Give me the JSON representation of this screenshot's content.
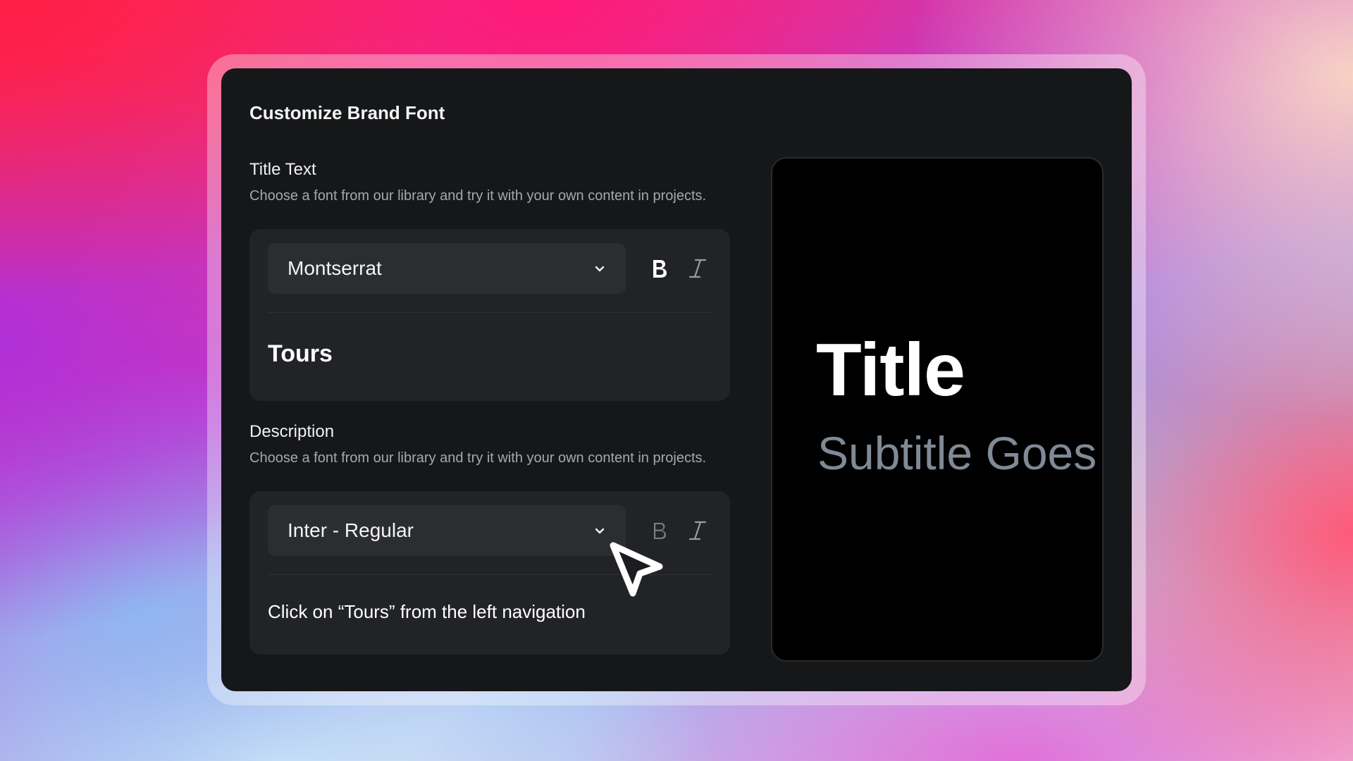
{
  "panel": {
    "title": "Customize Brand Font"
  },
  "title_section": {
    "label": "Title Text",
    "description": "Choose a font from our library and try it with your own content in projects.",
    "font_select": "Montserrat",
    "bold_label": "B",
    "italic_label": "I",
    "bold_active": true,
    "sample_text": "Tours"
  },
  "description_section": {
    "label": "Description",
    "description": "Choose a font from our library and try it with your own content in projects.",
    "font_select": "Inter - Regular",
    "bold_label": "B",
    "italic_label": "I",
    "bold_active": false,
    "sample_text": "Click on “Tours” from the left navigation"
  },
  "preview": {
    "title": "Title",
    "subtitle": "Subtitle Goes"
  },
  "colors": {
    "panel_bg": "#161719",
    "card_bg": "#222326",
    "select_bg": "#2b2d31",
    "subtitle": "#808a96"
  },
  "icons": [
    "chevron-down-icon",
    "bold-icon",
    "italic-icon",
    "mouse-cursor-icon"
  ]
}
